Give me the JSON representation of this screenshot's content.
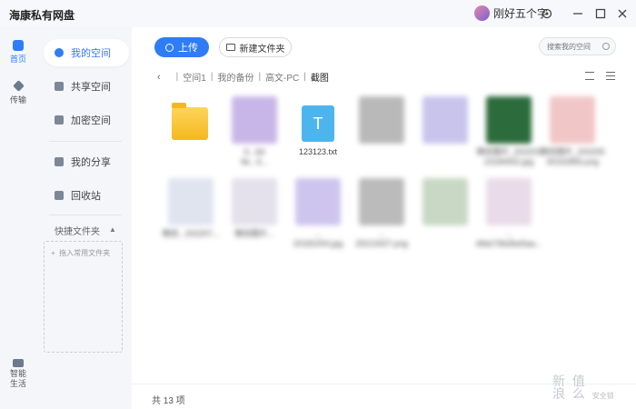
{
  "titlebar": {
    "app_title": "海康私有网盘",
    "username": "刚好五个字"
  },
  "rail": {
    "home": "首页",
    "transfer": "传输",
    "life": "智能\n生活"
  },
  "nav": {
    "items": [
      {
        "label": "我的空间",
        "active": true
      },
      {
        "label": "共享空间"
      },
      {
        "label": "加密空间"
      },
      {
        "label": "我的分享"
      },
      {
        "label": "回收站"
      }
    ],
    "quick_header": "快捷文件夹",
    "quick_hint": "拖入常用文件夹"
  },
  "toolbar": {
    "upload_label": "上传",
    "new_folder_label": "新建文件夹",
    "search_placeholder": "搜索我的空间"
  },
  "breadcrumb": {
    "parts": [
      "空间1",
      "我的备份",
      "高文-PC",
      "截图"
    ]
  },
  "files": [
    {
      "name": "",
      "kind": "folder"
    },
    {
      "name": "6...6d\n9e...6...",
      "kind": "image",
      "color": "#c9b6e8"
    },
    {
      "name": "123123.txt",
      "kind": "txt",
      "glyph": "T"
    },
    {
      "name": "",
      "kind": "image",
      "color": "#b9b9b9"
    },
    {
      "name": "",
      "kind": "image",
      "color": "#c8c4ec"
    },
    {
      "name": "微信图片_202203\n23184942.jpg",
      "kind": "image",
      "color": "#2c6b3b"
    },
    {
      "name": "微信图片_202205\n30152856.png",
      "kind": "image",
      "color": "#f1c6c6"
    },
    {
      "name": "微信...202207...",
      "kind": "image",
      "color": "#dfe4ef"
    },
    {
      "name": "微信图片...",
      "kind": "image",
      "color": "#e4e1ec"
    },
    {
      "name": "...\n20181004.jpg",
      "kind": "image",
      "color": "#cec5ee"
    },
    {
      "name": "...\n25213427.png",
      "kind": "image",
      "color": "#bbbbbb"
    },
    {
      "name": "",
      "kind": "image",
      "color": "#c8d8c4"
    },
    {
      "name": "...\ndfda73fa3be5aa...",
      "kind": "image",
      "color": "#e9dbe9"
    }
  ],
  "footer": {
    "count": "共 13 项"
  },
  "watermark": {
    "text": "新 值\n浪 么",
    "sub": "安全锁"
  }
}
